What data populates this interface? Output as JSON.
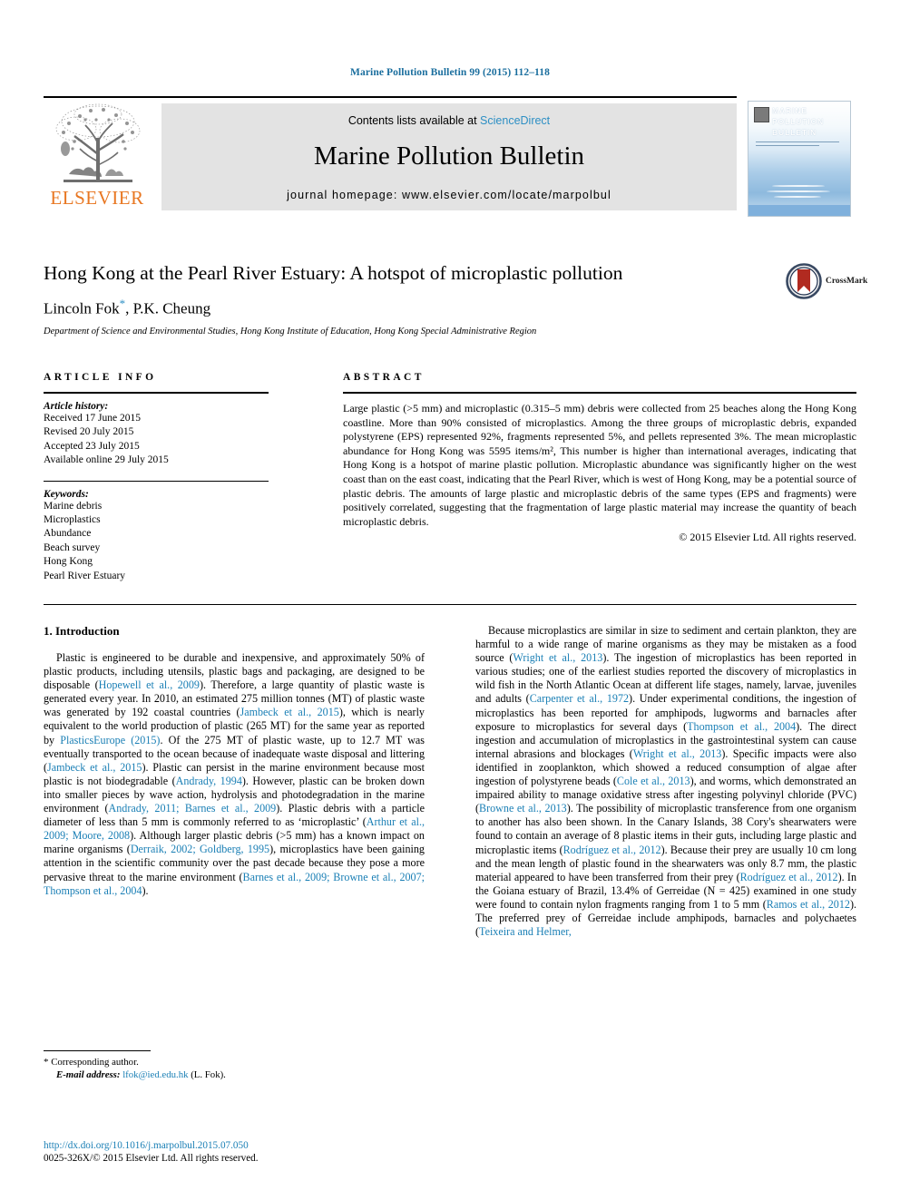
{
  "running_head": "Marine Pollution Bulletin 99 (2015) 112–118",
  "masthead": {
    "publisher": "ELSEVIER",
    "contents_prefix": "Contents lists available at ",
    "sciencedirect": "ScienceDirect",
    "journal_title": "Marine Pollution Bulletin",
    "homepage": "journal homepage: www.elsevier.com/locate/marpolbul",
    "cover": {
      "line1": "MARINE",
      "line2": "POLLUTION",
      "line3": "BULLETIN"
    }
  },
  "article": {
    "title": "Hong Kong at the Pearl River Estuary: A hotspot of microplastic pollution",
    "authors": "Lincoln Fok",
    "authors_rest": ", P.K. Cheung",
    "corresponding_marker": "*",
    "affiliation": "Department of Science and Environmental Studies, Hong Kong Institute of Education, Hong Kong Special Administrative Region",
    "crossmark_label": "CrossMark"
  },
  "article_info": {
    "heading": "ARTICLE INFO",
    "history_label": "Article history:",
    "history": [
      "Received 17 June 2015",
      "Revised 20 July 2015",
      "Accepted 23 July 2015",
      "Available online 29 July 2015"
    ],
    "keywords_label": "Keywords:",
    "keywords": [
      "Marine debris",
      "Microplastics",
      "Abundance",
      "Beach survey",
      "Hong Kong",
      "Pearl River Estuary"
    ]
  },
  "abstract": {
    "heading": "ABSTRACT",
    "text": "Large plastic (>5 mm) and microplastic (0.315–5 mm) debris were collected from 25 beaches along the Hong Kong coastline. More than 90% consisted of microplastics. Among the three groups of microplastic debris, expanded polystyrene (EPS) represented 92%, fragments represented 5%, and pellets represented 3%. The mean microplastic abundance for Hong Kong was 5595 items/m², This number is higher than international averages, indicating that Hong Kong is a hotspot of marine plastic pollution. Microplastic abundance was significantly higher on the west coast than on the east coast, indicating that the Pearl River, which is west of Hong Kong, may be a potential source of plastic debris. The amounts of large plastic and microplastic debris of the same types (EPS and fragments) were positively correlated, suggesting that the fragmentation of large plastic material may increase the quantity of beach microplastic debris.",
    "copyright": "© 2015 Elsevier Ltd. All rights reserved."
  },
  "body": {
    "section_heading": "1. Introduction",
    "left_paragraph_1": "Plastic is engineered to be durable and inexpensive, and approximately 50% of plastic products, including utensils, plastic bags and packaging, are designed to be disposable (",
    "left_ref_1": "Hopewell et al., 2009",
    "left_paragraph_1b": "). Therefore, a large quantity of plastic waste is generated every year. In 2010, an estimated 275 million tonnes (MT) of plastic waste was generated by 192 coastal countries (",
    "left_ref_2": "Jambeck et al., 2015",
    "left_paragraph_1c": "), which is nearly equivalent to the world production of plastic (265 MT) for the same year as reported by ",
    "left_ref_3": "PlasticsEurope (2015)",
    "left_paragraph_1d": ". Of the 275 MT of plastic waste, up to 12.7 MT was eventually transported to the ocean because of inadequate waste disposal and littering (",
    "left_ref_4": "Jambeck et al., 2015",
    "left_paragraph_1e": "). Plastic can persist in the marine environment because most plastic is not biodegradable (",
    "left_ref_5": "Andrady, 1994",
    "left_paragraph_1f": "). However, plastic can be broken down into smaller pieces by wave action, hydrolysis and photodegradation in the marine environment (",
    "left_ref_6": "Andrady, 2011; Barnes et al., 2009",
    "left_paragraph_1g": "). Plastic debris with a particle diameter of less than 5 mm is commonly referred to as ‘microplastic’ (",
    "left_ref_7": "Arthur et al., 2009; Moore, 2008",
    "left_paragraph_1h": "). Although larger plastic debris (>5 mm) has a known impact on marine organisms (",
    "left_ref_8": "Derraik, 2002; Goldberg, 1995",
    "left_paragraph_1i": "), microplastics have been gaining attention in the scientific community over the past decade because they pose a more pervasive threat to the marine environment (",
    "left_ref_9": "Barnes et al., 2009; Browne et al., 2007; Thompson et al., 2004",
    "left_paragraph_1j": ").",
    "right_paragraph_1": "Because microplastics are similar in size to sediment and certain plankton, they are harmful to a wide range of marine organisms as they may be mistaken as a food source (",
    "right_ref_1": "Wright et al., 2013",
    "right_paragraph_1b": "). The ingestion of microplastics has been reported in various studies; one of the earliest studies reported the discovery of microplastics in wild fish in the North Atlantic Ocean at different life stages, namely, larvae, juveniles and adults (",
    "right_ref_2": "Carpenter et al., 1972",
    "right_paragraph_1c": "). Under experimental conditions, the ingestion of microplastics has been reported for amphipods, lugworms and barnacles after exposure to microplastics for several days (",
    "right_ref_3": "Thompson et al., 2004",
    "right_paragraph_1d": "). The direct ingestion and accumulation of microplastics in the gastrointestinal system can cause internal abrasions and blockages (",
    "right_ref_4": "Wright et al., 2013",
    "right_paragraph_1e": "). Specific impacts were also identified in zooplankton, which showed a reduced consumption of algae after ingestion of polystyrene beads (",
    "right_ref_5": "Cole et al., 2013",
    "right_paragraph_1f": "), and worms, which demonstrated an impaired ability to manage oxidative stress after ingesting polyvinyl chloride (PVC) (",
    "right_ref_6": "Browne et al., 2013",
    "right_paragraph_1g": "). The possibility of microplastic transference from one organism to another has also been shown. In the Canary Islands, 38 Cory's shearwaters were found to contain an average of 8 plastic items in their guts, including large plastic and microplastic items (",
    "right_ref_7": "Rodríguez et al., 2012",
    "right_paragraph_1h": "). Because their prey are usually 10 cm long and the mean length of plastic found in the shearwaters was only 8.7 mm, the plastic material appeared to have been transferred from their prey (",
    "right_ref_8": "Rodríguez et al., 2012",
    "right_paragraph_1i": "). In the Goiana estuary of Brazil, 13.4% of Gerreidae (N = 425) examined in one study were found to contain nylon fragments ranging from 1 to 5 mm (",
    "right_ref_9": "Ramos et al., 2012",
    "right_paragraph_1j": "). The preferred prey of Gerreidae include amphipods, barnacles and polychaetes (",
    "right_ref_10": "Teixeira and Helmer,"
  },
  "footnote": {
    "star": "*",
    "corresponding": "Corresponding author.",
    "email_label": "E-mail address:",
    "email": "lfok@ied.edu.hk",
    "email_suffix": " (L. Fok)."
  },
  "footer": {
    "doi": "http://dx.doi.org/10.1016/j.marpolbul.2015.07.050",
    "issn": "0025-326X/© 2015 Elsevier Ltd. All rights reserved."
  },
  "colors": {
    "link": "#1a7fb5",
    "sciencedirect": "#2d8fc4",
    "elsevier_orange": "#e87722",
    "running_head": "#1a6e9e"
  }
}
